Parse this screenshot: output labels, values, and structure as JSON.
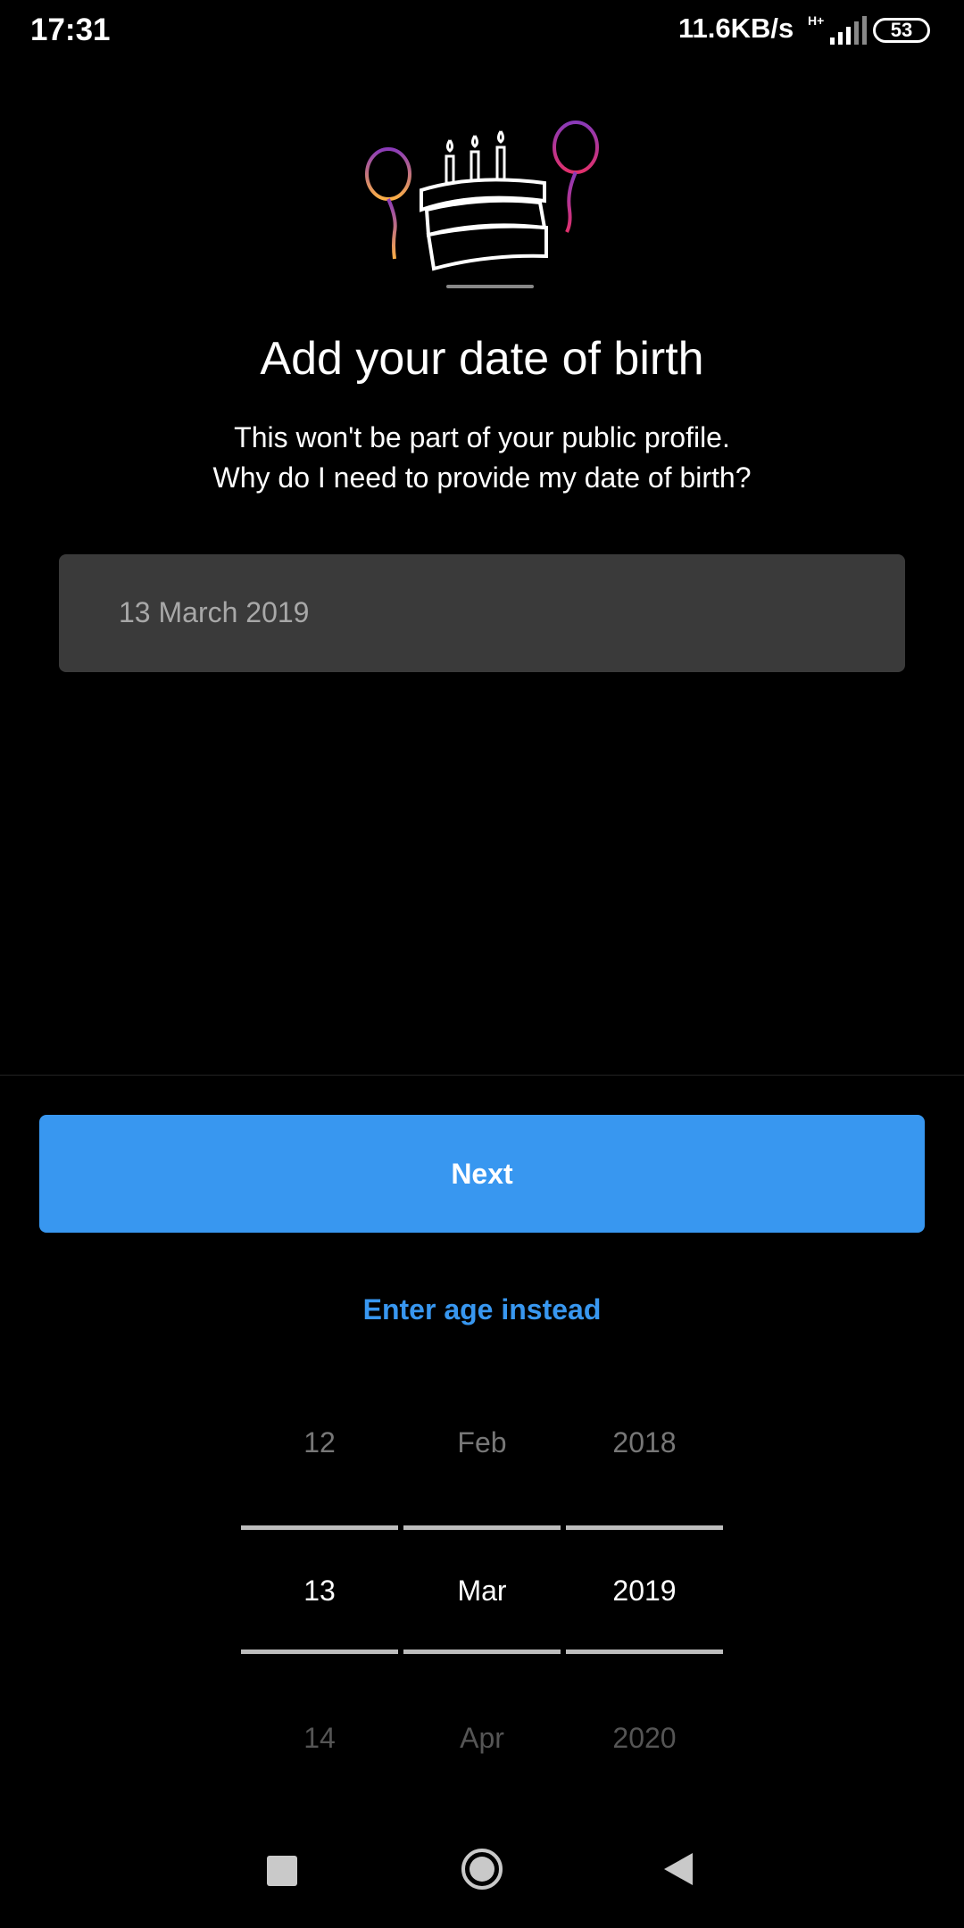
{
  "status_bar": {
    "time": "17:31",
    "network_speed": "11.6KB/s",
    "network_type": "H+",
    "battery_level": "53"
  },
  "illustration": {
    "icon": "birthday-cake-with-balloons",
    "colors": {
      "balloon_gradient_start": "#8a3ab9",
      "balloon_gradient_end": "#fcaf45",
      "line": "#ffffff"
    }
  },
  "header": {
    "title": "Add your date of birth",
    "subtitle_line1": "This won't be part of your public profile.",
    "subtitle_line2": "Why do I need to provide my date of birth?"
  },
  "date_field": {
    "value": "13 March 2019"
  },
  "actions": {
    "next_label": "Next",
    "enter_age_label": "Enter age instead"
  },
  "date_picker": {
    "day": {
      "prev": "12",
      "selected": "13",
      "next": "14"
    },
    "month": {
      "prev": "Feb",
      "selected": "Mar",
      "next": "Apr"
    },
    "year": {
      "prev": "2018",
      "selected": "2019",
      "next": "2020"
    }
  },
  "nav_bar": {
    "recents": "square-icon",
    "home": "circle-icon",
    "back": "triangle-back-icon"
  },
  "colors": {
    "background": "#000000",
    "accent": "#3897f0",
    "field_background": "#3a3a3a"
  }
}
